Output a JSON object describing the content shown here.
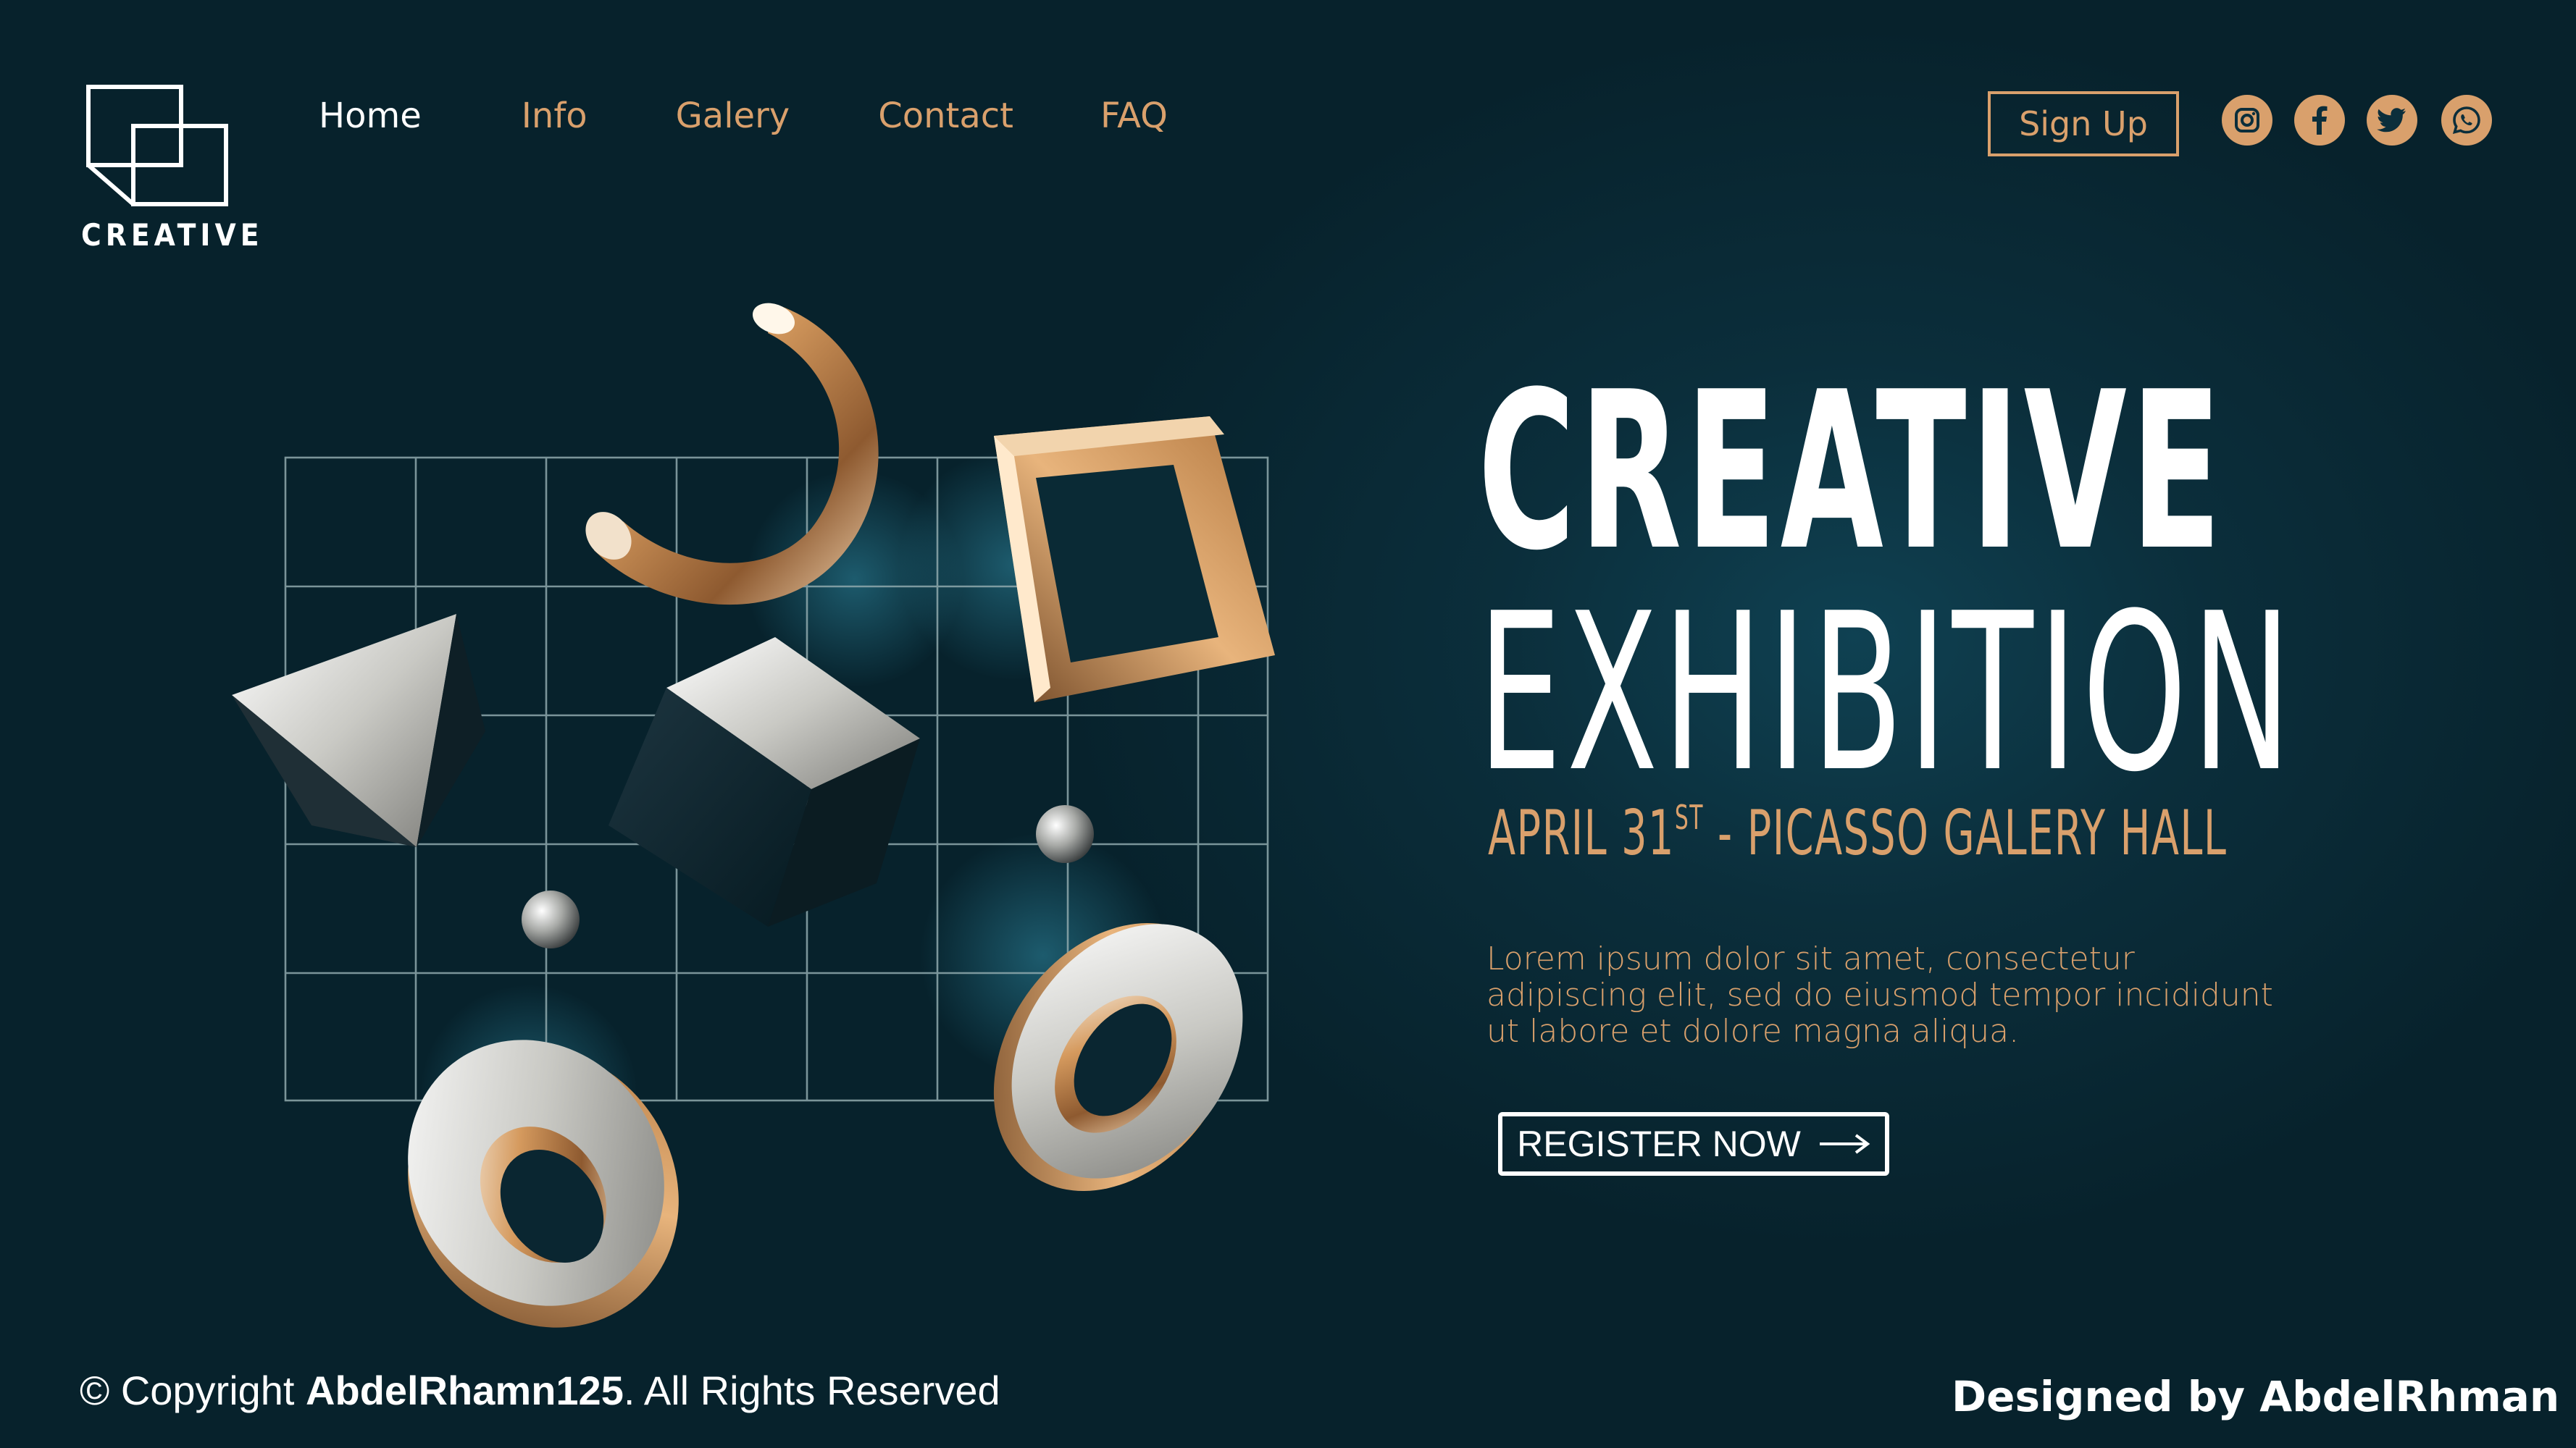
{
  "logo": {
    "text": "CREATIVE",
    "icon": "overlapping-squares-icon"
  },
  "nav": {
    "items": [
      {
        "label": "Home",
        "active": true
      },
      {
        "label": "Info",
        "active": false
      },
      {
        "label": "Galery",
        "active": false
      },
      {
        "label": "Contact",
        "active": false
      },
      {
        "label": "FAQ",
        "active": false
      }
    ]
  },
  "header": {
    "signup_label": "Sign Up",
    "social": [
      "instagram-icon",
      "facebook-icon",
      "twitter-icon",
      "whatsapp-icon"
    ]
  },
  "hero": {
    "title_line1": "CREATIVE",
    "title_line2": "EXHIBITION",
    "date_prefix": "APRIL 31",
    "date_suffix": "ST",
    "venue": " - PICASSO GALERY HALL",
    "description": "Lorem ipsum dolor sit amet, consectetur adipiscing elit, sed do eiusmod tempor incididunt ut labore et dolore magna aliqua.",
    "register_label": "REGISTER NOW"
  },
  "footer": {
    "copyright_prefix": "© Copyright ",
    "copyright_name": "AbdelRhamn125",
    "copyright_suffix": ". All Rights Reserved",
    "designer": "Designed by AbdelRhman"
  },
  "colors": {
    "accent": "#d9a06c",
    "background": "#0b2e3b",
    "text": "#ffffff"
  }
}
